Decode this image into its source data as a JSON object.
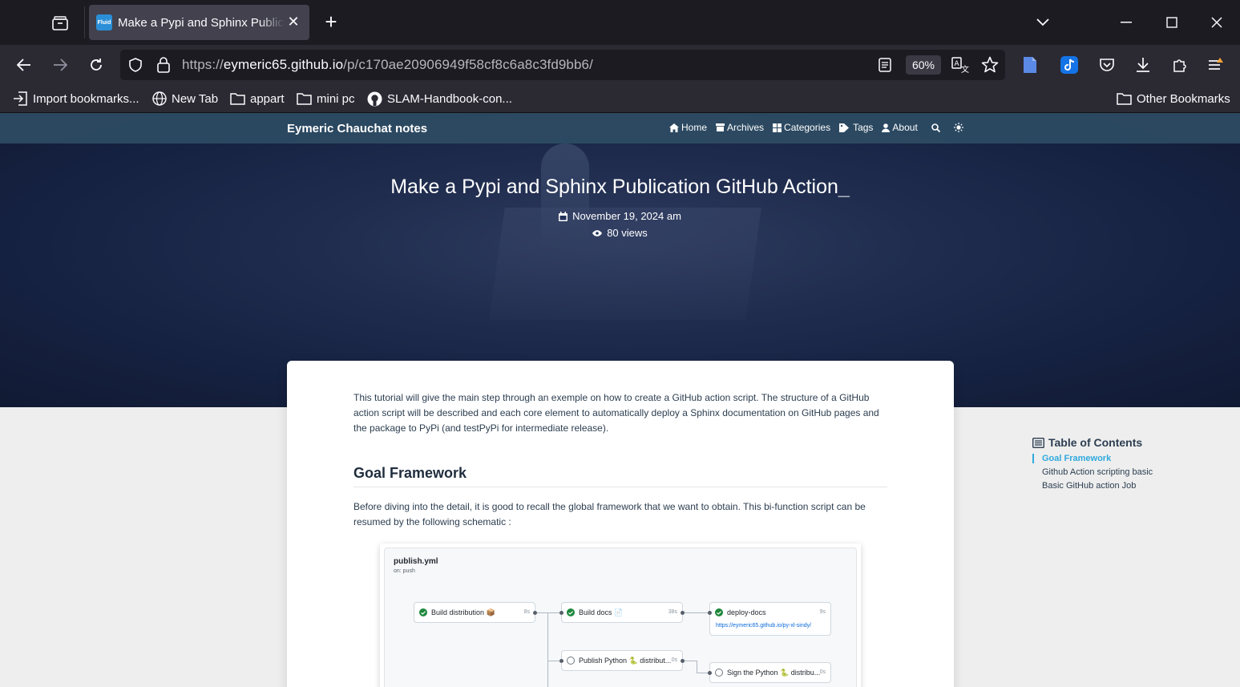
{
  "browser": {
    "tab_title": "Make a Pypi and Sphinx Publication GitHub Action",
    "favicon_text": "Fluid",
    "url_prefix": "https://",
    "url_host": "eymeric65.github.io",
    "url_path": "/p/c170ae20906949f58cf8c6a8c3fd9bb6/",
    "zoom": "60%",
    "bookmarks": [
      {
        "label": "Import bookmarks...",
        "icon": "import-icon"
      },
      {
        "label": "New Tab",
        "icon": "globe-icon"
      },
      {
        "label": "appart",
        "icon": "folder-icon"
      },
      {
        "label": "mini pc",
        "icon": "folder-icon"
      },
      {
        "label": "SLAM-Handbook-con...",
        "icon": "github-icon"
      }
    ],
    "other_bookmarks": "Other Bookmarks"
  },
  "site": {
    "brand": "Eymeric Chauchat notes",
    "menu": [
      {
        "label": "Home",
        "icon": "home-icon"
      },
      {
        "label": "Archives",
        "icon": "archive-icon"
      },
      {
        "label": "Categories",
        "icon": "grid-icon"
      },
      {
        "label": "Tags",
        "icon": "tag-icon"
      },
      {
        "label": "About",
        "icon": "user-icon"
      }
    ]
  },
  "post": {
    "title": "Make a Pypi and Sphinx Publication GitHub Action",
    "date": "November 19, 2024 am",
    "views": "80 views",
    "intro": "This tutorial will give the main step through an exemple on how to create a GitHub action script. The structure of a GitHub action script will be described and each core element to automatically deploy a Sphinx documentation on GitHub pages and the package to PyPi (and testPyPi for intermediate release).",
    "section_heading": "Goal Framework",
    "section_text": "Before diving into the detail, it is good to recall the global framework that we want to obtain. This bi-function script can be resumed by the following schematic :"
  },
  "workflow": {
    "name": "publish.yml",
    "trigger": "on: push",
    "jobs": {
      "build_distribution": {
        "label": "Build distribution 📦",
        "duration": "8s"
      },
      "build_docs": {
        "label": "Build docs 📄",
        "duration": "38s"
      },
      "deploy_docs": {
        "label": "deploy-docs",
        "duration": "9s",
        "link": "https://eymeric65.github.io/py-xl-sindy/"
      },
      "publish_python": {
        "label": "Publish Python 🐍 distribut...",
        "duration": "0s"
      },
      "sign_python": {
        "label": "Sign the Python 🐍 distribu...",
        "duration": "0s"
      }
    }
  },
  "toc": {
    "title": "Table of Contents",
    "items": [
      "Goal Framework",
      "Github Action scripting basic",
      "Basic GitHub action Job"
    ]
  }
}
